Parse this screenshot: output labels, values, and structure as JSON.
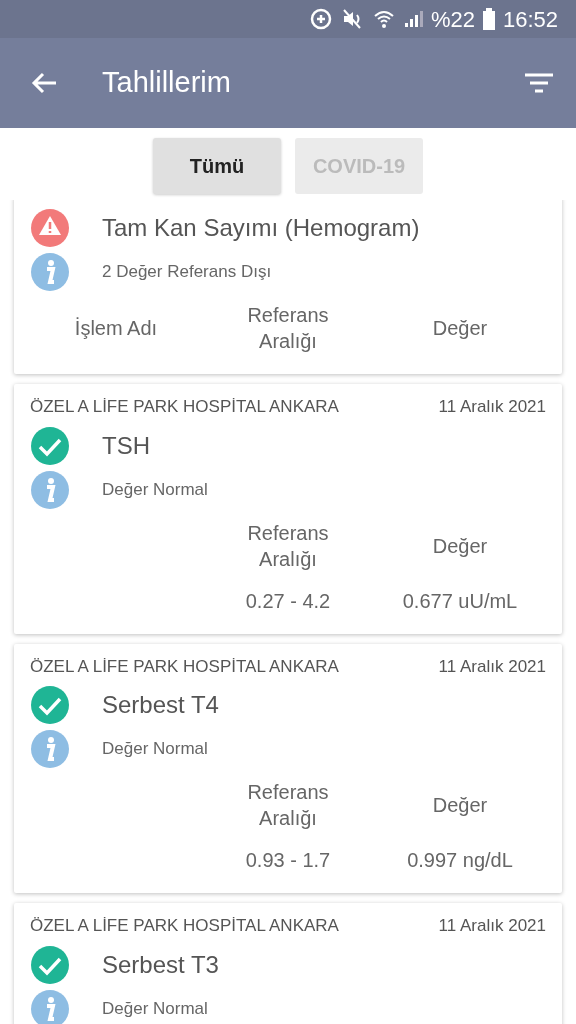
{
  "status_bar": {
    "battery": "%22",
    "time": "16:52"
  },
  "app_bar": {
    "title": "Tahlillerim"
  },
  "filters": [
    {
      "label": "Tümü",
      "selected": true
    },
    {
      "label": "COVID-19",
      "selected": false
    }
  ],
  "results": [
    {
      "out_of_range": true,
      "test": "Tam Kan Sayımı (Hemogram)",
      "note": "2 Değer Referans Dışı",
      "columns": [
        "İşlem Adı",
        "Referans Aralığı",
        "Değer"
      ]
    },
    {
      "hospital": "ÖZEL A LİFE PARK HOSPİTAL ANKARA",
      "date": "11 Aralık 2021",
      "out_of_range": false,
      "test": "TSH",
      "note": "Değer Normal",
      "columns": [
        "Referans Aralığı",
        "Değer"
      ],
      "values": [
        "0.27 - 4.2",
        "0.677 uU/mL"
      ]
    },
    {
      "hospital": "ÖZEL A LİFE PARK HOSPİTAL ANKARA",
      "date": "11 Aralık 2021",
      "out_of_range": false,
      "test": "Serbest T4",
      "note": "Değer Normal",
      "columns": [
        "Referans Aralığı",
        "Değer"
      ],
      "values": [
        "0.93 - 1.7",
        "0.997 ng/dL"
      ]
    },
    {
      "hospital": "ÖZEL A LİFE PARK HOSPİTAL ANKARA",
      "date": "11 Aralık 2021",
      "out_of_range": false,
      "test": "Serbest T3",
      "note": "Değer Normal"
    }
  ]
}
